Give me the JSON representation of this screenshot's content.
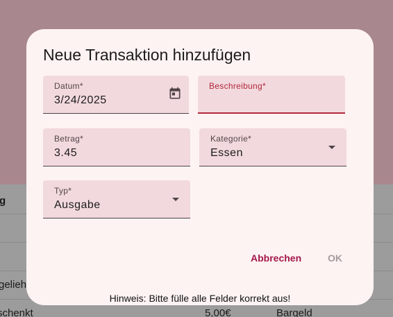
{
  "background": {
    "table_header_partial": "g",
    "rows": [
      {
        "text": "geliehen",
        "amount": "",
        "payment": ""
      },
      {
        "text": "schenkt",
        "amount": "5,00€",
        "payment": "Bargeld"
      }
    ]
  },
  "dialog": {
    "title": "Neue Transaktion hinzufügen",
    "fields": {
      "datum": {
        "label": "Datum*",
        "value": "3/24/2025",
        "icon": "calendar-icon"
      },
      "beschreibung": {
        "label": "Beschreibung*",
        "value": ""
      },
      "betrag": {
        "label": "Betrag*",
        "value": "3.45"
      },
      "kategorie": {
        "label": "Kategorie*",
        "value": "Essen"
      },
      "typ": {
        "label": "Typ*",
        "value": "Ausgabe"
      }
    },
    "buttons": {
      "cancel": "Abbrechen",
      "ok": "OK"
    },
    "hint": "Hinweis: Bitte fülle alle Felder korrekt aus!"
  },
  "colors": {
    "accent": "#a3174a",
    "error": "#b3253a",
    "field_bg": "#f1d9dd",
    "dialog_bg": "#fdf3f3",
    "scrim_top": "#a8878e"
  }
}
